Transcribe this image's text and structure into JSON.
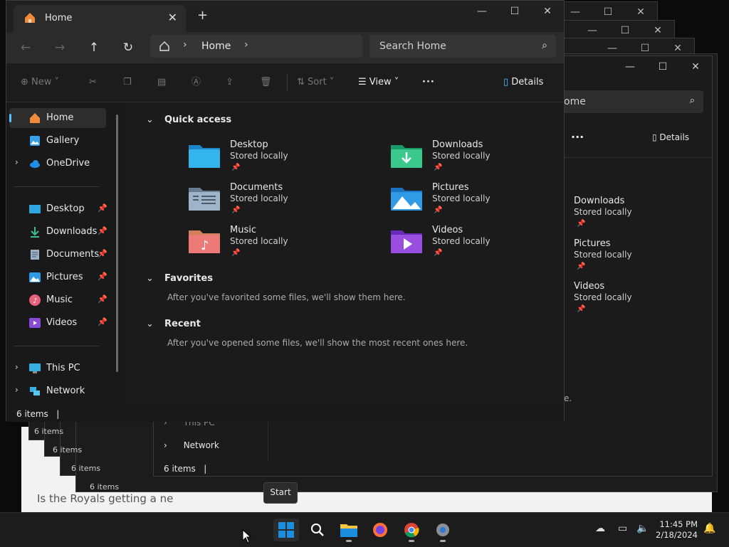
{
  "background": {
    "partial_text": "Is the Royals getting a ne",
    "ghost_status": [
      "6 items",
      "6 items",
      "6 items",
      "6 items"
    ]
  },
  "back_window": {
    "search_fragment": "ome",
    "details_label": "Details",
    "tiles": [
      {
        "name": "Downloads",
        "sub": "Stored locally"
      },
      {
        "name": "Pictures",
        "sub": "Stored locally"
      },
      {
        "name": "Videos",
        "sub": "Stored locally"
      }
    ],
    "nav": [
      {
        "label": "This PC"
      },
      {
        "label": "Network"
      }
    ],
    "status": "6 items",
    "fragment": "e."
  },
  "window": {
    "tab_title": "Home",
    "address": "Home",
    "search_placeholder": "Search Home",
    "toolbar": {
      "new": "New",
      "sort": "Sort",
      "view": "View",
      "details": "Details"
    },
    "sidebar": {
      "top": [
        {
          "label": "Home"
        },
        {
          "label": "Gallery"
        },
        {
          "label": "OneDrive"
        }
      ],
      "pinned": [
        {
          "label": "Desktop"
        },
        {
          "label": "Downloads"
        },
        {
          "label": "Documents"
        },
        {
          "label": "Pictures"
        },
        {
          "label": "Music"
        },
        {
          "label": "Videos"
        }
      ],
      "bottom": [
        {
          "label": "This PC"
        },
        {
          "label": "Network"
        }
      ]
    },
    "quick_access": {
      "heading": "Quick access",
      "tiles": [
        {
          "name": "Desktop",
          "sub": "Stored locally"
        },
        {
          "name": "Downloads",
          "sub": "Stored locally"
        },
        {
          "name": "Documents",
          "sub": "Stored locally"
        },
        {
          "name": "Pictures",
          "sub": "Stored locally"
        },
        {
          "name": "Music",
          "sub": "Stored locally"
        },
        {
          "name": "Videos",
          "sub": "Stored locally"
        }
      ]
    },
    "favorites": {
      "heading": "Favorites",
      "message": "After you've favorited some files, we'll show them here."
    },
    "recent": {
      "heading": "Recent",
      "message": "After you've opened some files, we'll show the most recent ones here."
    },
    "status": "6 items"
  },
  "tooltip": "Start",
  "taskbar": {
    "time": "11:45 PM",
    "date": "2/18/2024"
  },
  "colors": {
    "accent": "#4cc2ff",
    "folder_yellow": "#f4c542",
    "start_blue": "#1a8fe0"
  }
}
